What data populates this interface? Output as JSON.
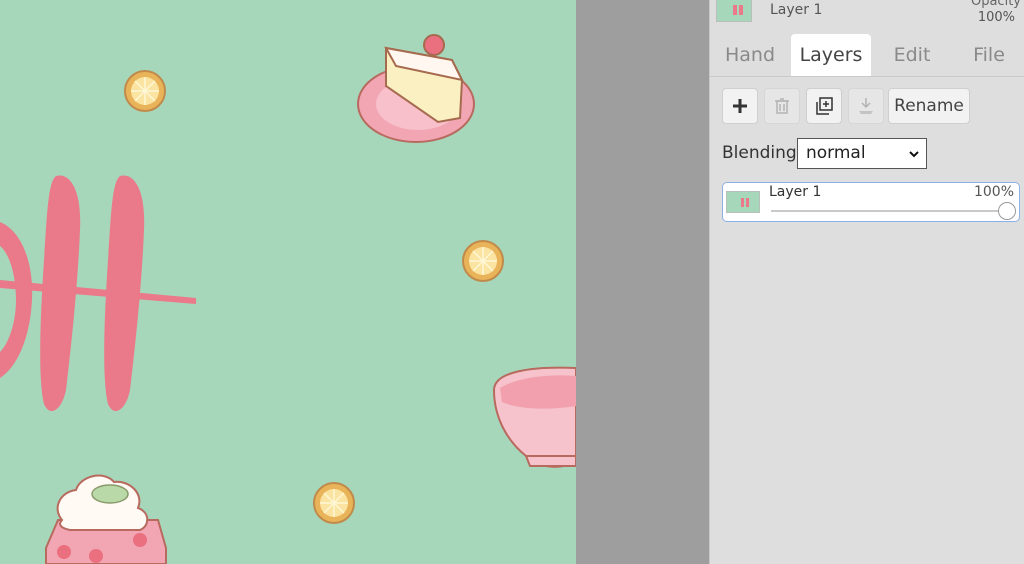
{
  "top_layer": {
    "name": "Layer 1",
    "opacity_label": "Opacity",
    "opacity_value": "100%"
  },
  "tabs": [
    {
      "label": "Hand",
      "active": false
    },
    {
      "label": "Layers",
      "active": true
    },
    {
      "label": "Edit",
      "active": false
    },
    {
      "label": "File",
      "active": false
    }
  ],
  "toolbar": {
    "add_icon": "plus-icon",
    "delete_icon": "trash-icon",
    "duplicate_icon": "duplicate-layer-icon",
    "merge_icon": "merge-down-icon",
    "rename_label": "Rename"
  },
  "blending": {
    "label": "Blending",
    "value": "normal"
  },
  "layers": [
    {
      "name": "Layer 1",
      "opacity": "100%",
      "opacity_fraction": 1.0
    }
  ],
  "colors": {
    "canvas_bg": "#a7d7bb",
    "lettering_pink": "#ea7a89",
    "panel_bg": "#dedede",
    "workspace_gray": "#9e9e9e"
  }
}
